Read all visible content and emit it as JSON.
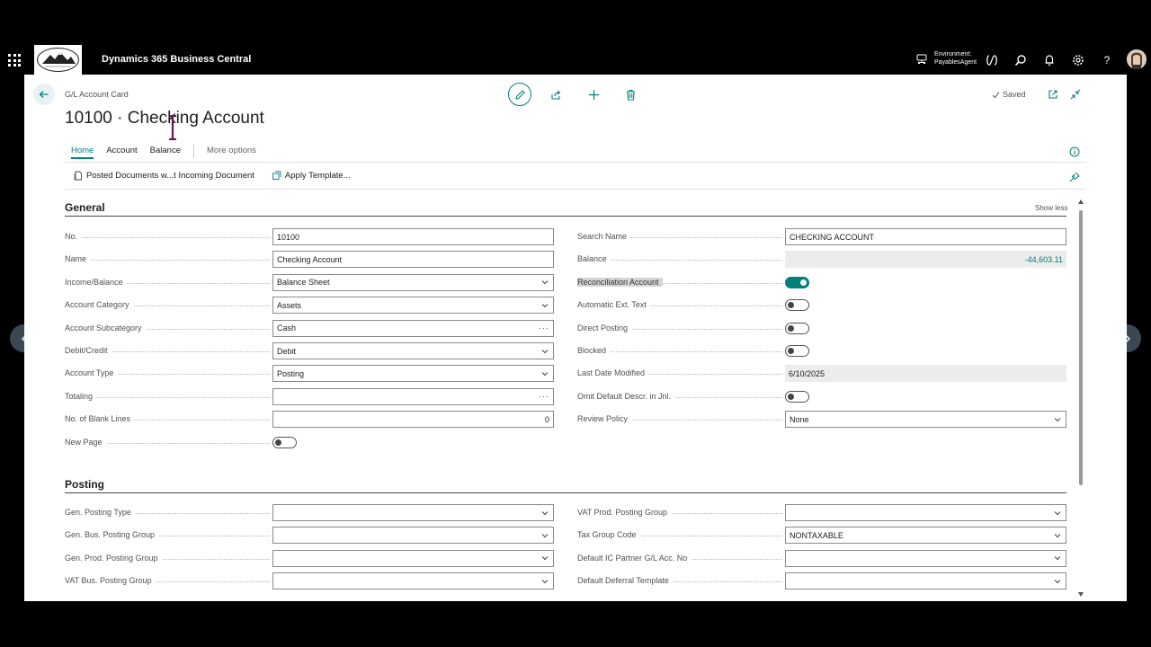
{
  "app": {
    "title": "Dynamics 365 Business Central",
    "environment_label": "Environment:",
    "environment_name": "PayablesAgent"
  },
  "header": {
    "breadcrumb": "G/L Account Card",
    "title": "10100 · Checking Account",
    "saved_label": "Saved"
  },
  "tabs": [
    {
      "label": "Home",
      "active": true
    },
    {
      "label": "Account",
      "active": false
    },
    {
      "label": "Balance",
      "active": false
    }
  ],
  "more_options": "More options",
  "actions": {
    "posted_docs": "Posted Documents w...t Incoming Document",
    "apply_template": "Apply Template..."
  },
  "general": {
    "title": "General",
    "show_less": "Show less",
    "left": [
      {
        "label": "No.",
        "value": "10100",
        "kind": "text"
      },
      {
        "label": "Name",
        "value": "Checking Account",
        "kind": "text"
      },
      {
        "label": "Income/Balance",
        "value": "Balance Sheet",
        "kind": "select"
      },
      {
        "label": "Account Category",
        "value": "Assets",
        "kind": "select"
      },
      {
        "label": "Account Subcategory",
        "value": "Cash",
        "kind": "lookup"
      },
      {
        "label": "Debit/Credit",
        "value": "Debit",
        "kind": "select"
      },
      {
        "label": "Account Type",
        "value": "Posting",
        "kind": "select"
      },
      {
        "label": "Totaling",
        "value": "",
        "kind": "lookup"
      },
      {
        "label": "No. of Blank Lines",
        "value": "0",
        "kind": "number"
      },
      {
        "label": "New Page",
        "value": false,
        "kind": "toggle"
      }
    ],
    "right": [
      {
        "label": "Search Name",
        "value": "CHECKING ACCOUNT",
        "kind": "text"
      },
      {
        "label": "Balance",
        "value": "-44,603.11",
        "kind": "readonly-balance"
      },
      {
        "label": "Reconciliation Account",
        "value": true,
        "kind": "toggle"
      },
      {
        "label": "Automatic Ext. Text",
        "value": false,
        "kind": "toggle"
      },
      {
        "label": "Direct Posting",
        "value": false,
        "kind": "toggle"
      },
      {
        "label": "Blocked",
        "value": false,
        "kind": "toggle"
      },
      {
        "label": "Last Date Modified",
        "value": "6/10/2025",
        "kind": "readonly"
      },
      {
        "label": "Omit Default Descr. in Jnl.",
        "value": false,
        "kind": "toggle"
      },
      {
        "label": "Review Policy",
        "value": "None",
        "kind": "select"
      }
    ]
  },
  "posting": {
    "title": "Posting",
    "left": [
      {
        "label": "Gen. Posting Type",
        "value": "",
        "kind": "select"
      },
      {
        "label": "Gen. Bus. Posting Group",
        "value": "",
        "kind": "select"
      },
      {
        "label": "Gen. Prod. Posting Group",
        "value": "",
        "kind": "select"
      },
      {
        "label": "VAT Bus. Posting Group",
        "value": "",
        "kind": "select"
      }
    ],
    "right": [
      {
        "label": "VAT Prod. Posting Group",
        "value": "",
        "kind": "select"
      },
      {
        "label": "Tax Group Code",
        "value": "NONTAXABLE",
        "kind": "select"
      },
      {
        "label": "Default IC Partner G/L Acc. No",
        "value": "",
        "kind": "select"
      },
      {
        "label": "Default Deferral Template",
        "value": "",
        "kind": "select"
      }
    ]
  },
  "colors": {
    "accent": "#00817a",
    "topbar": "#000000"
  }
}
